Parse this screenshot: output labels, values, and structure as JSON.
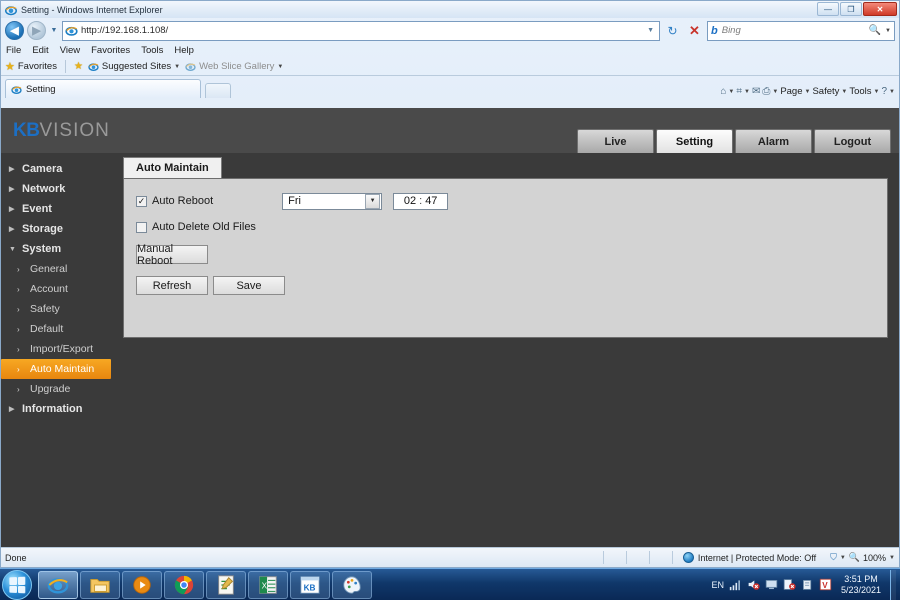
{
  "window": {
    "title": "Setting - Windows Internet Explorer",
    "minimize_label": "—",
    "maximize_label": "❐",
    "close_label": "✕"
  },
  "browser": {
    "back_label": "◀",
    "forward_label": "▶",
    "recent_label": "▼",
    "url": "http://192.168.1.108/",
    "url_dropdown_label": "▼",
    "refresh_label": "↻",
    "stop_label": "✕",
    "search": {
      "provider": "b",
      "placeholder": "Bing",
      "go_label": "🔍",
      "dropdown_label": "▼"
    },
    "menus": [
      "File",
      "Edit",
      "View",
      "Favorites",
      "Tools",
      "Help"
    ],
    "favorites_bar": {
      "favorites_label": "Favorites",
      "items": [
        {
          "label": "Suggested Sites",
          "has_caret": true
        },
        {
          "label": "Web Slice Gallery",
          "has_caret": true
        }
      ]
    },
    "tabs": [
      {
        "label": "Setting",
        "active": true
      }
    ],
    "new_tab_label": "",
    "command_bar": [
      {
        "name": "home-icon",
        "glyph": "⌂",
        "caret": true
      },
      {
        "name": "feeds-icon",
        "glyph": "📡",
        "caret": true
      },
      {
        "name": "mail-icon",
        "glyph": "✉",
        "caret": false
      },
      {
        "name": "print-icon",
        "glyph": "🖶",
        "caret": true
      },
      {
        "name": "page-menu",
        "glyph": "Page",
        "caret": true
      },
      {
        "name": "safety-menu",
        "glyph": "Safety",
        "caret": true
      },
      {
        "name": "tools-menu",
        "glyph": "Tools",
        "caret": true
      },
      {
        "name": "help-menu",
        "glyph": "?",
        "caret": true
      }
    ]
  },
  "device_ui": {
    "brand": {
      "kb": "KB",
      "vision": "VISION"
    },
    "nav_buttons": [
      {
        "label": "Live",
        "active": false
      },
      {
        "label": "Setting",
        "active": true
      },
      {
        "label": "Alarm",
        "active": false
      },
      {
        "label": "Logout",
        "active": false
      }
    ],
    "sidebar": [
      {
        "label": "Camera",
        "type": "group",
        "marker": "▶",
        "active": false
      },
      {
        "label": "Network",
        "type": "group",
        "marker": "▶",
        "active": false
      },
      {
        "label": "Event",
        "type": "group",
        "marker": "▶",
        "active": false
      },
      {
        "label": "Storage",
        "type": "group",
        "marker": "▶",
        "active": false
      },
      {
        "label": "System",
        "type": "group",
        "marker": "▼",
        "active": false
      },
      {
        "label": "General",
        "type": "sub",
        "marker": "›",
        "active": false
      },
      {
        "label": "Account",
        "type": "sub",
        "marker": "›",
        "active": false
      },
      {
        "label": "Safety",
        "type": "sub",
        "marker": "›",
        "active": false
      },
      {
        "label": "Default",
        "type": "sub",
        "marker": "›",
        "active": false
      },
      {
        "label": "Import/Export",
        "type": "sub",
        "marker": "›",
        "active": false
      },
      {
        "label": "Auto Maintain",
        "type": "sub",
        "marker": "›",
        "active": true
      },
      {
        "label": "Upgrade",
        "type": "sub",
        "marker": "›",
        "active": false
      },
      {
        "label": "Information",
        "type": "group",
        "marker": "▶",
        "active": false
      }
    ],
    "panel": {
      "tab_label": "Auto Maintain",
      "auto_reboot": {
        "label": "Auto Reboot",
        "checked": true,
        "check_glyph": "✓",
        "day": "Fri",
        "day_arrow": "▼",
        "hour": "02",
        "time_separator": ":",
        "minute": "47"
      },
      "auto_delete": {
        "label": "Auto Delete Old Files",
        "checked": false,
        "check_glyph": ""
      },
      "manual_reboot_label": "Manual Reboot",
      "refresh_label": "Refresh",
      "save_label": "Save"
    },
    "accent_color": "#f09010"
  },
  "status_bar": {
    "message": "Done",
    "zone": "Internet | Protected Mode: Off",
    "zone_caret": "▼",
    "zoom_level": "100%",
    "zoom_caret": "▼"
  },
  "taskbar": {
    "buttons": [
      {
        "name": "taskbar-ie",
        "label": "Internet Explorer",
        "state": "on"
      },
      {
        "name": "taskbar-explorer",
        "label": "Windows Explorer",
        "state": "lit"
      },
      {
        "name": "taskbar-media-player",
        "label": "Windows Media Player",
        "state": "lit"
      },
      {
        "name": "taskbar-chrome",
        "label": "Google Chrome",
        "state": "lit"
      },
      {
        "name": "taskbar-notepad",
        "label": "Notepad",
        "state": "lit"
      },
      {
        "name": "taskbar-excel",
        "label": "Excel",
        "state": "lit"
      },
      {
        "name": "taskbar-kb",
        "label": "KB",
        "state": "lit"
      },
      {
        "name": "taskbar-paint",
        "label": "Paint",
        "state": "lit"
      }
    ],
    "tray": {
      "language": "EN",
      "icons": [
        "network-icon",
        "volume-muted-icon",
        "display-icon",
        "antivirus-icon",
        "safely-remove-icon",
        "vlc-icon"
      ],
      "time": "3:51 PM",
      "date": "5/23/2021"
    }
  }
}
